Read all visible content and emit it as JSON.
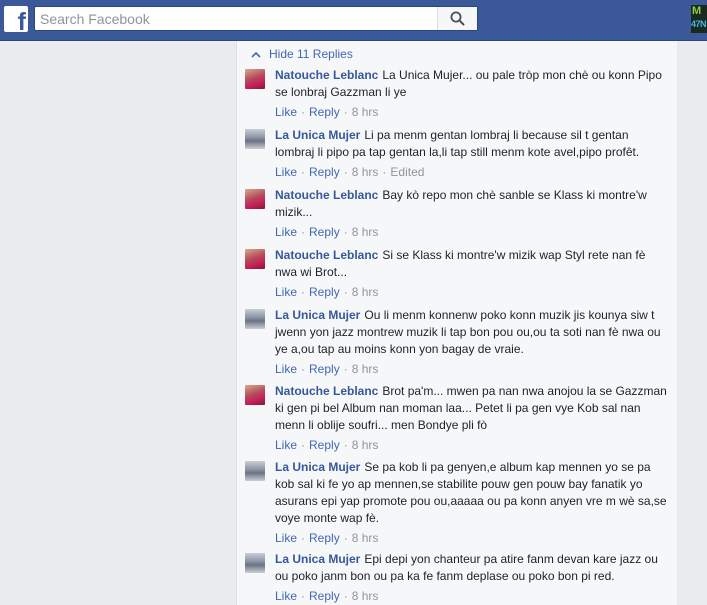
{
  "header": {
    "logo_glyph": "f",
    "search_placeholder": "Search Facebook",
    "badge_top": "M",
    "badge_bottom": "47N"
  },
  "replies_toggle": {
    "label": "Hide 11 Replies"
  },
  "comments": [
    {
      "author": "Natouche Leblanc",
      "text": "La Unica Mujer... ou pale tròp mon chè ou konn Pipo se lonbraj Gazzman li ye",
      "like": "Like",
      "reply": "Reply",
      "time": "8 hrs",
      "edited": ""
    },
    {
      "author": "La Unica Mujer",
      "text": "Li pa menm gentan lombraj li because sil t gentan lombraj li pipo pa tap gentan la,li tap still menm kote avel,pipo profêt.",
      "like": "Like",
      "reply": "Reply",
      "time": "8 hrs",
      "edited": "Edited"
    },
    {
      "author": "Natouche Leblanc",
      "text": "Bay kò repo mon chè sanble se Klass ki montre'w mizik...",
      "like": "Like",
      "reply": "Reply",
      "time": "8 hrs",
      "edited": ""
    },
    {
      "author": "Natouche Leblanc",
      "text": "Si se Klass ki montre'w mizik wap Styl rete nan fè nwa wi Brot...",
      "like": "Like",
      "reply": "Reply",
      "time": "8 hrs",
      "edited": ""
    },
    {
      "author": "La Unica Mujer",
      "text": "Ou li menm konnenw poko konn muzik jis kounya siw t jwenn yon jazz montrew muzik li tap bon pou ou,ou ta soti nan fè nwa ou ye a,ou tap au moins konn yon bagay de vraie.",
      "like": "Like",
      "reply": "Reply",
      "time": "8 hrs",
      "edited": ""
    },
    {
      "author": "Natouche Leblanc",
      "text": "Brot pa'm... mwen pa nan nwa anojou la se Gazzman ki gen pi bel Album nan moman laa... Petet li pa gen vye Kob sal nan menn li oblije soufri... men Bondye pli fò",
      "like": "Like",
      "reply": "Reply",
      "time": "8 hrs",
      "edited": ""
    },
    {
      "author": "La Unica Mujer",
      "text": "Se pa kob li pa genyen,e album kap mennen yo se pa kob sal ki fe yo ap mennen,se stabilite pouw gen pouw bay fanatik yo asurans epi yap promote pou ou,aaaaa ou pa konn anyen vre m wè sa,se voye monte wap fè.",
      "like": "Like",
      "reply": "Reply",
      "time": "8 hrs",
      "edited": ""
    },
    {
      "author": "La Unica Mujer",
      "text": "Epi depi yon chanteur pa atire fanm devan kare jazz ou ou poko janm bon ou pa ka fe fanm deplase ou poko bon pi red.",
      "like": "Like",
      "reply": "Reply",
      "time": "8 hrs",
      "edited": ""
    }
  ]
}
